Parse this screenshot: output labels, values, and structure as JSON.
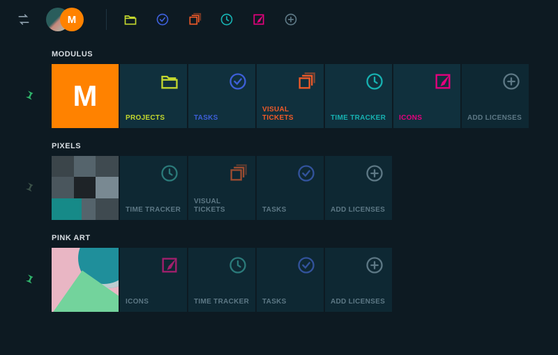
{
  "topbar": {
    "avatar_letter": "M"
  },
  "sections": {
    "modulus": {
      "title": "MODULUS",
      "hero_letter": "M",
      "projects": "PROJECTS",
      "tasks": "TASKS",
      "visual_tickets": "VISUAL TICKETS",
      "time_tracker": "TIME TRACKER",
      "icons": "ICONS",
      "add_licenses": "ADD LICENSES"
    },
    "pixels": {
      "title": "PIXELS",
      "time_tracker": "TIME TRACKER",
      "visual_tickets": "VISUAL TICKETS",
      "tasks": "TASKS",
      "add_licenses": "ADD LICENSES"
    },
    "pinkart": {
      "title": "PINK ART",
      "icons": "ICONS",
      "time_tracker": "TIME TRACKER",
      "tasks": "TASKS",
      "add_licenses": "ADD LICENSES"
    }
  }
}
